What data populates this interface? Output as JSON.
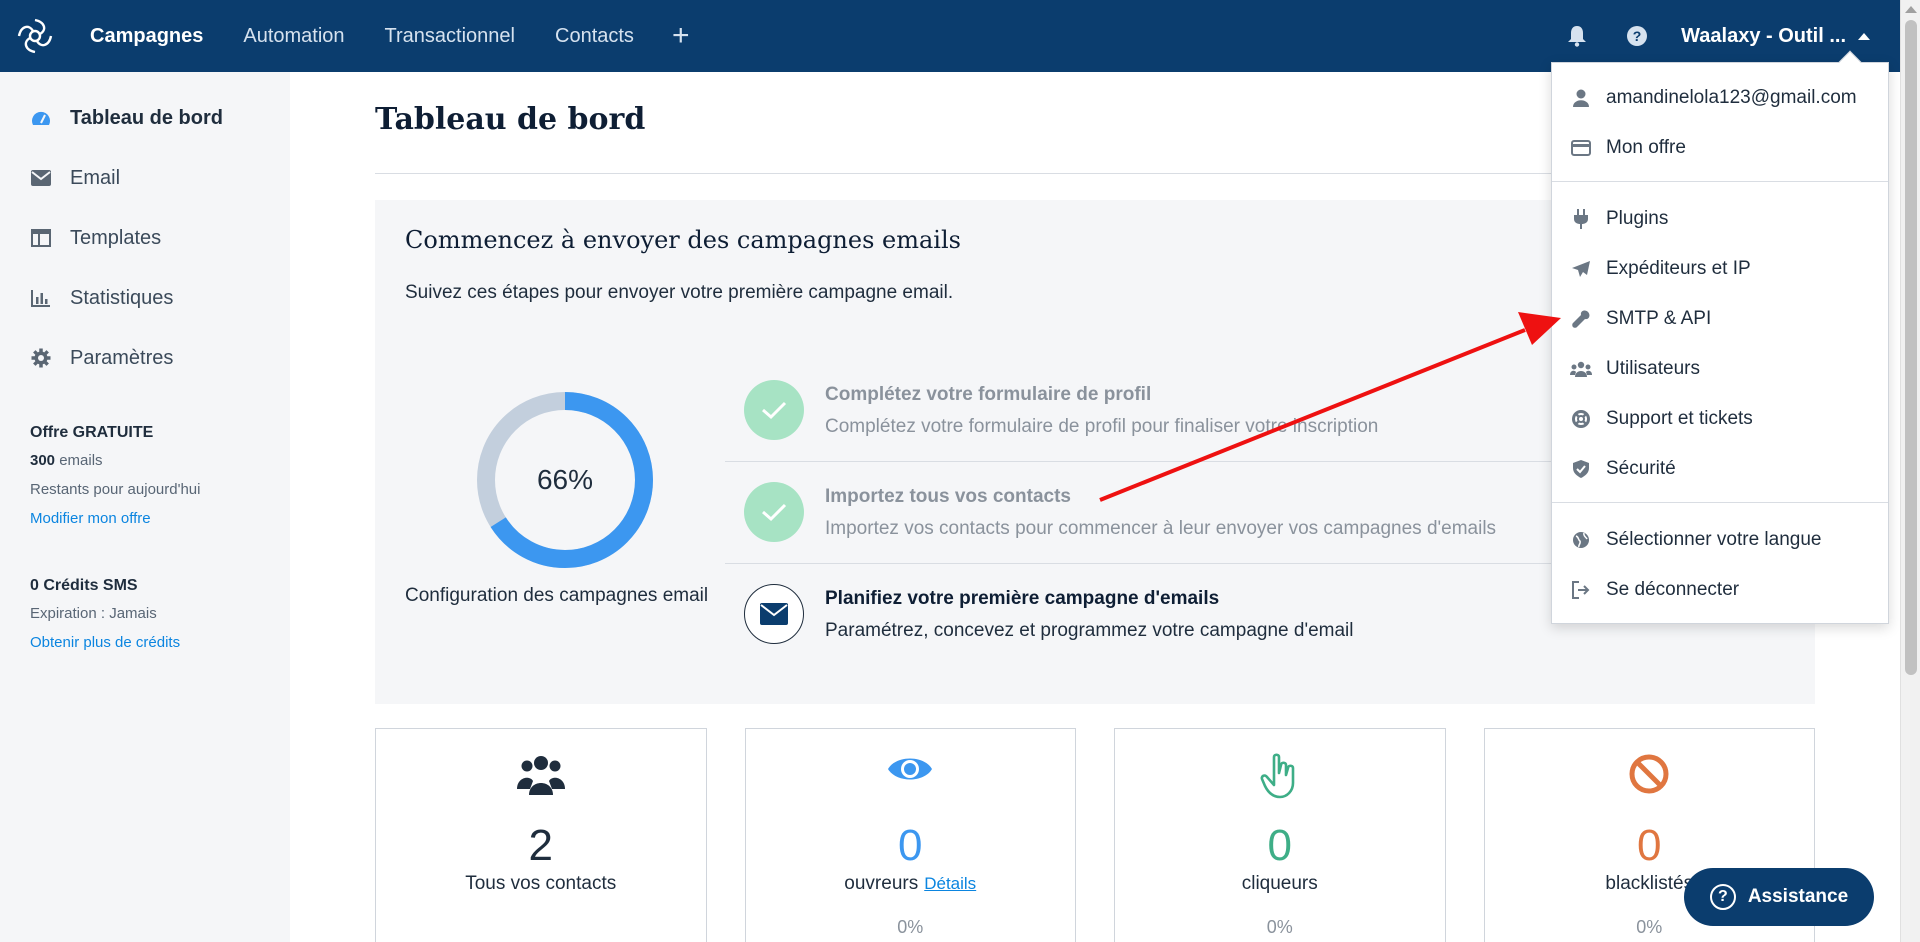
{
  "nav": {
    "items": [
      "Campagnes",
      "Automation",
      "Transactionnel",
      "Contacts"
    ],
    "plus": "+",
    "account": "Waalaxy - Outil ..."
  },
  "sidebar": {
    "items": [
      {
        "label": "Tableau de bord",
        "icon": "dashboard-icon"
      },
      {
        "label": "Email",
        "icon": "envelope-icon"
      },
      {
        "label": "Templates",
        "icon": "template-icon"
      },
      {
        "label": "Statistiques",
        "icon": "bar-chart-icon"
      },
      {
        "label": "Paramètres",
        "icon": "gear-icon"
      }
    ],
    "offer": {
      "title": "Offre GRATUITE",
      "emails_count": "300",
      "emails_label": "emails",
      "remaining": "Restants pour aujourd'hui",
      "link": "Modifier mon offre"
    },
    "sms": {
      "title": "0 Crédits SMS",
      "expiration": "Expiration : Jamais",
      "link": "Obtenir plus de crédits"
    }
  },
  "main": {
    "title": "Tableau de bord",
    "onboarding": {
      "heading": "Commencez à envoyer des campagnes emails",
      "subtitle": "Suivez ces étapes pour envoyer votre première campagne email.",
      "progress_label": "66%",
      "progress_value": 0.66,
      "caption": "Configuration des campagnes email",
      "steps": [
        {
          "title": "Complétez votre formulaire de profil",
          "desc": "Complétez votre formulaire de profil pour finaliser votre inscription",
          "status": "done"
        },
        {
          "title": "Importez tous vos contacts",
          "desc": "Importez vos contacts pour commencer à leur envoyer vos campagnes d'emails",
          "status": "done"
        },
        {
          "title": "Planifiez votre première campagne d'emails",
          "desc": "Paramétrez, concevez et programmez votre campagne d'email",
          "status": "current"
        }
      ]
    },
    "stats": [
      {
        "value": "2",
        "label": "Tous vos contacts",
        "pct": "",
        "color": "#1f2d3d",
        "icon": "users-icon"
      },
      {
        "value": "0",
        "label": "ouvreurs",
        "link": "Détails",
        "pct": "0%",
        "color": "#3c97f0",
        "icon": "eye-icon"
      },
      {
        "value": "0",
        "label": "cliqueurs",
        "pct": "0%",
        "color": "#3eae87",
        "icon": "pointer-hand-icon"
      },
      {
        "value": "0",
        "label": "blacklistés",
        "pct": "0%",
        "color": "#e07640",
        "icon": "ban-icon"
      }
    ]
  },
  "dropdown": {
    "email": "amandinelola123@gmail.com",
    "items_group1": [
      "Mon offre"
    ],
    "items_group2": [
      "Plugins",
      "Expéditeurs et IP",
      "SMTP & API",
      "Utilisateurs",
      "Support et tickets",
      "Sécurité"
    ],
    "items_group3": [
      "Sélectionner votre langue",
      "Se déconnecter"
    ]
  },
  "assistance": {
    "label": "Assistance"
  },
  "colors": {
    "nav": "#0b3d6e",
    "accent": "#3c97f0",
    "annotation": "#ee1111"
  }
}
